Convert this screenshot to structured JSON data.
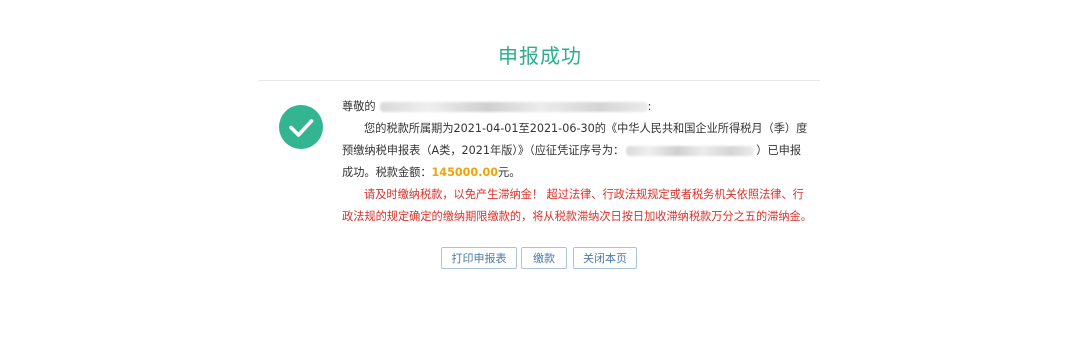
{
  "page": {
    "title": "申报成功"
  },
  "message": {
    "greeting_prefix": "尊敬的",
    "greeting_suffix": ":",
    "line1": "您的税款所属期为2021-04-01至2021-06-30的《中华人民共和国企业所得税月（季）度预缴纳税申报表（A类，2021年版）》（应征凭证序号为：",
    "line1_suffix": "）已申报成功。税款金额：",
    "amount": "145000.00",
    "amount_unit": "元。",
    "warning": "请及时缴纳税款，以免产生滞纳金！ 超过法律、行政法规规定或者税务机关依照法律、行政法规的规定确定的缴纳期限缴款的，将从税款滞纳次日按日加收滞纳税款万分之五的滞纳金。"
  },
  "buttons": {
    "print_label": "打印申报表",
    "pay_label": "缴款",
    "close_label": "关闭本页"
  },
  "colors": {
    "title": "#2eae8f",
    "success_icon": "#34b592",
    "amount": "#f0a30a",
    "warning": "#d9312b",
    "button_text": "#4a7aa6"
  },
  "icons": {
    "success": "check-circle-icon"
  }
}
